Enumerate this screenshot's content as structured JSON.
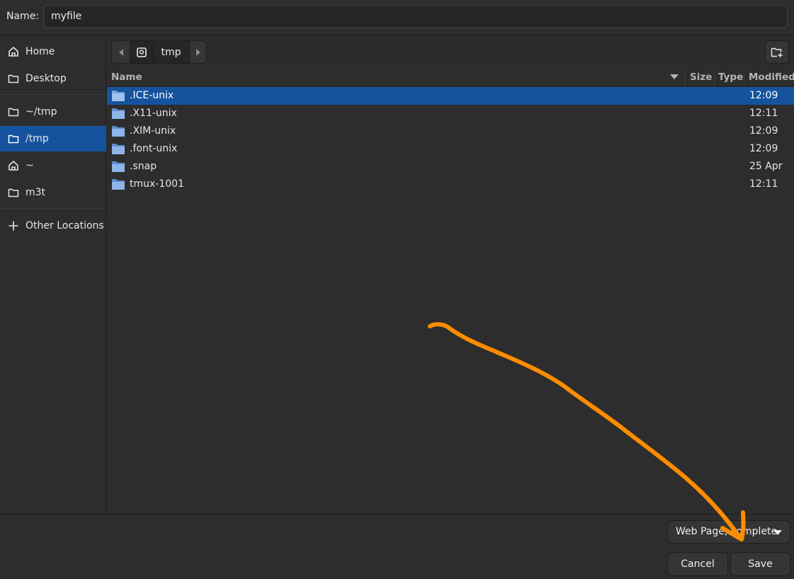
{
  "name_field": {
    "label": "Name:",
    "value": "myfile"
  },
  "sidebar": {
    "items": [
      {
        "label": "Home",
        "icon": "home-icon"
      },
      {
        "label": "Desktop",
        "icon": "folder-icon"
      },
      {
        "label": "~/tmp",
        "icon": "folder-icon"
      },
      {
        "label": "/tmp",
        "icon": "folder-icon",
        "selected": true
      },
      {
        "label": "~",
        "icon": "home-icon"
      },
      {
        "label": "m3t",
        "icon": "folder-icon"
      },
      {
        "label": "Other Locations",
        "icon": "plus-icon"
      }
    ]
  },
  "pathbar": {
    "current": "tmp"
  },
  "columns": {
    "name": "Name",
    "size": "Size",
    "type": "Type",
    "modified": "Modified"
  },
  "files": [
    {
      "name": ".ICE-unix",
      "modified": "12:09",
      "selected": true
    },
    {
      "name": ".X11-unix",
      "modified": "12:11"
    },
    {
      "name": ".XIM-unix",
      "modified": "12:09"
    },
    {
      "name": ".font-unix",
      "modified": "12:09"
    },
    {
      "name": ".snap",
      "modified": "25 Apr"
    },
    {
      "name": "tmux-1001",
      "modified": "12:11"
    }
  ],
  "filter": {
    "value": "Web Page, complete"
  },
  "buttons": {
    "cancel": "Cancel",
    "save": "Save"
  },
  "colors": {
    "selection": "#15539e",
    "annotation_arrow": "#ff8c00",
    "folder": "#7aa7e0"
  }
}
